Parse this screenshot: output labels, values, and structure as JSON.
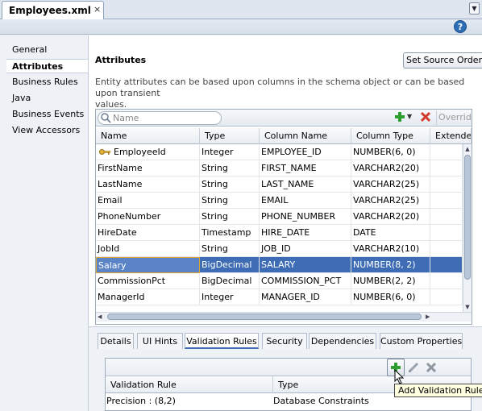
{
  "editor_tab": {
    "title": "Employees.xml",
    "close": "×"
  },
  "help": {
    "label": "?"
  },
  "nav": {
    "items": [
      {
        "label": "General",
        "selected": false
      },
      {
        "label": "Attributes",
        "selected": true
      },
      {
        "label": "Business Rules",
        "selected": false
      },
      {
        "label": "Java",
        "selected": false
      },
      {
        "label": "Business Events",
        "selected": false
      },
      {
        "label": "View Accessors",
        "selected": false
      }
    ]
  },
  "attributes": {
    "title": "Attributes",
    "set_source_order_label": "Set Source Order",
    "description": "Entity attributes can be based upon columns in the schema object or can be based upon transient\nvalues.",
    "search_placeholder": "Name",
    "override_label": "Override",
    "columns": [
      "Name",
      "Type",
      "Column Name",
      "Column Type",
      "Extended"
    ],
    "rows": [
      {
        "name": "EmployeeId",
        "type": "Integer",
        "column": "EMPLOYEE_ID",
        "coltype": "NUMBER(6, 0)",
        "key": true
      },
      {
        "name": "FirstName",
        "type": "String",
        "column": "FIRST_NAME",
        "coltype": "VARCHAR2(20)"
      },
      {
        "name": "LastName",
        "type": "String",
        "column": "LAST_NAME",
        "coltype": "VARCHAR2(25)"
      },
      {
        "name": "Email",
        "type": "String",
        "column": "EMAIL",
        "coltype": "VARCHAR2(25)"
      },
      {
        "name": "PhoneNumber",
        "type": "String",
        "column": "PHONE_NUMBER",
        "coltype": "VARCHAR2(20)"
      },
      {
        "name": "HireDate",
        "type": "Timestamp",
        "column": "HIRE_DATE",
        "coltype": "DATE"
      },
      {
        "name": "JobId",
        "type": "String",
        "column": "JOB_ID",
        "coltype": "VARCHAR2(10)"
      },
      {
        "name": "Salary",
        "type": "BigDecimal",
        "column": "SALARY",
        "coltype": "NUMBER(8, 2)",
        "selected": true
      },
      {
        "name": "CommissionPct",
        "type": "BigDecimal",
        "column": "COMMISSION_PCT",
        "coltype": "NUMBER(2, 2)"
      },
      {
        "name": "ManagerId",
        "type": "Integer",
        "column": "MANAGER_ID",
        "coltype": "NUMBER(6, 0)"
      }
    ]
  },
  "detail_tabs": {
    "items": [
      {
        "label": "Details",
        "selected": false
      },
      {
        "label": "UI Hints",
        "selected": false
      },
      {
        "label": "Validation Rules",
        "selected": true
      },
      {
        "label": "Security",
        "selected": false
      },
      {
        "label": "Dependencies",
        "selected": false
      },
      {
        "label": "Custom Properties",
        "selected": false
      }
    ]
  },
  "validation": {
    "columns": [
      "Validation Rule",
      "Type"
    ],
    "rows": [
      {
        "rule": "Precision : (8,2)",
        "type": "Database Constraints"
      }
    ],
    "tooltip": "Add Validation Rule"
  },
  "colors": {
    "selection": "#3f6db5",
    "accent_green": "#2e9e2e",
    "delete_red": "#d23a2a"
  }
}
